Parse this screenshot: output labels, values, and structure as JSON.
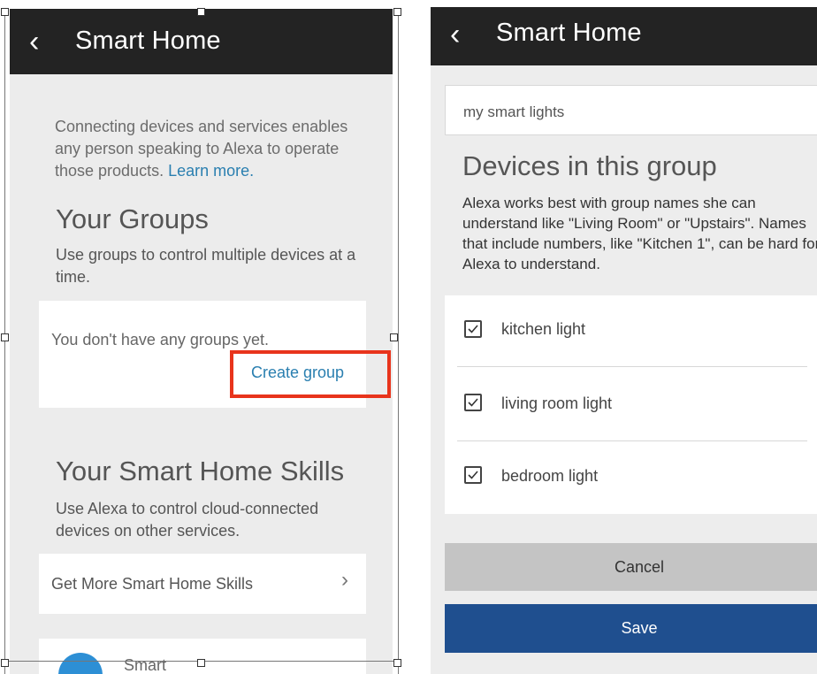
{
  "left": {
    "header": {
      "back_icon": "chevron-left-icon",
      "title": "Smart Home"
    },
    "intro": {
      "text": "Connecting devices and services enables any person speaking to Alexa to operate those products.",
      "link": "Learn more."
    },
    "groups": {
      "title": "Your Groups",
      "description": "Use groups to control multiple devices at a time.",
      "empty_text": "You don't have any groups yet.",
      "create_label": "Create group"
    },
    "skills": {
      "title": "Your Smart Home Skills",
      "description": "Use Alexa to control cloud-connected devices on other services.",
      "get_more_label": "Get More Smart Home Skills",
      "partial_item_label": "Smart"
    }
  },
  "right": {
    "header": {
      "back_icon": "chevron-left-icon",
      "title": "Smart Home"
    },
    "group_name_value": "my smart lights",
    "devices_title": "Devices in this group",
    "devices_description": "Alexa works best with group names she can understand like \"Living Room\" or \"Upstairs\". Names that include numbers, like \"Kitchen 1\", can be hard for Alexa to understand.",
    "devices": [
      {
        "label": "kitchen light",
        "checked": true
      },
      {
        "label": "living room light",
        "checked": true
      },
      {
        "label": "bedroom light",
        "checked": true
      }
    ],
    "cancel_label": "Cancel",
    "save_label": "Save"
  },
  "colors": {
    "header_bg": "#232323",
    "link": "#2a7fb0",
    "highlight_box": "#e8341c",
    "cancel_bg": "#c4c4c4",
    "save_bg": "#1f4f8f"
  }
}
